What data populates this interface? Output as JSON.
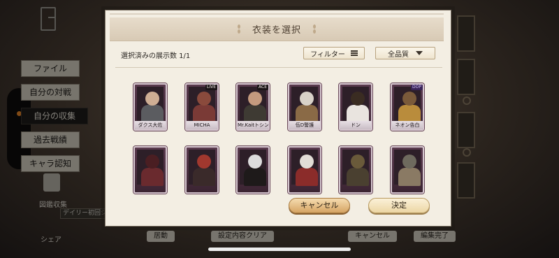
{
  "background": {
    "menu": [
      "ファイル",
      "自分の対戦",
      "自分の収集",
      "過去戦績",
      "キャラ認知"
    ],
    "active_menu_index": 2,
    "collection_label": "図鑑収集",
    "daily_label": "デイリー初回シェア",
    "share_label": "シェア",
    "bottom_buttons": [
      "居動",
      "設定内容クリア",
      "キャンセル",
      "編集完了"
    ]
  },
  "modal": {
    "title": "衣装を選択",
    "selected_count": "選択済みの展示数 1/1",
    "filter_label": "フィルター",
    "quality_value": "全品質",
    "cancel_label": "キャンセル",
    "confirm_label": "決定"
  },
  "costumes": [
    {
      "name": "ダクス大佐",
      "badge": "",
      "head": "#cfae94",
      "body": "#5b5c60"
    },
    {
      "name": "MICHA",
      "badge": "LIVE",
      "head": "#8a4a3c",
      "body": "#7a3a36"
    },
    {
      "name": "Mr.Kaitトシンド",
      "badge": "ACE",
      "head": "#c49a7e",
      "body": "#3e3a33"
    },
    {
      "name": "伍D警護",
      "badge": "",
      "head": "#d9d2c8",
      "body": "#8a6a46"
    },
    {
      "name": "ドン",
      "badge": "",
      "head": "#3a2c22",
      "body": "#e9e4df"
    },
    {
      "name": "ネオン告白",
      "badge": "DOP",
      "head": "#7a5a3a",
      "body": "#b98c3c"
    },
    {
      "name": "",
      "badge": "",
      "head": "#4a1e22",
      "body": "#6a2a2e"
    },
    {
      "name": "",
      "badge": "",
      "head": "#a1382e",
      "body": "#3a2a2a"
    },
    {
      "name": "",
      "badge": "",
      "head": "#dcdcdc",
      "body": "#1e1a1a"
    },
    {
      "name": "",
      "badge": "",
      "head": "#e2ddd6",
      "body": "#8b2c2a"
    },
    {
      "name": "",
      "badge": "",
      "head": "#6a5a3a",
      "body": "#4a4030"
    },
    {
      "name": "",
      "badge": "",
      "head": "#6e6a5e",
      "body": "#8a7a64"
    }
  ]
}
